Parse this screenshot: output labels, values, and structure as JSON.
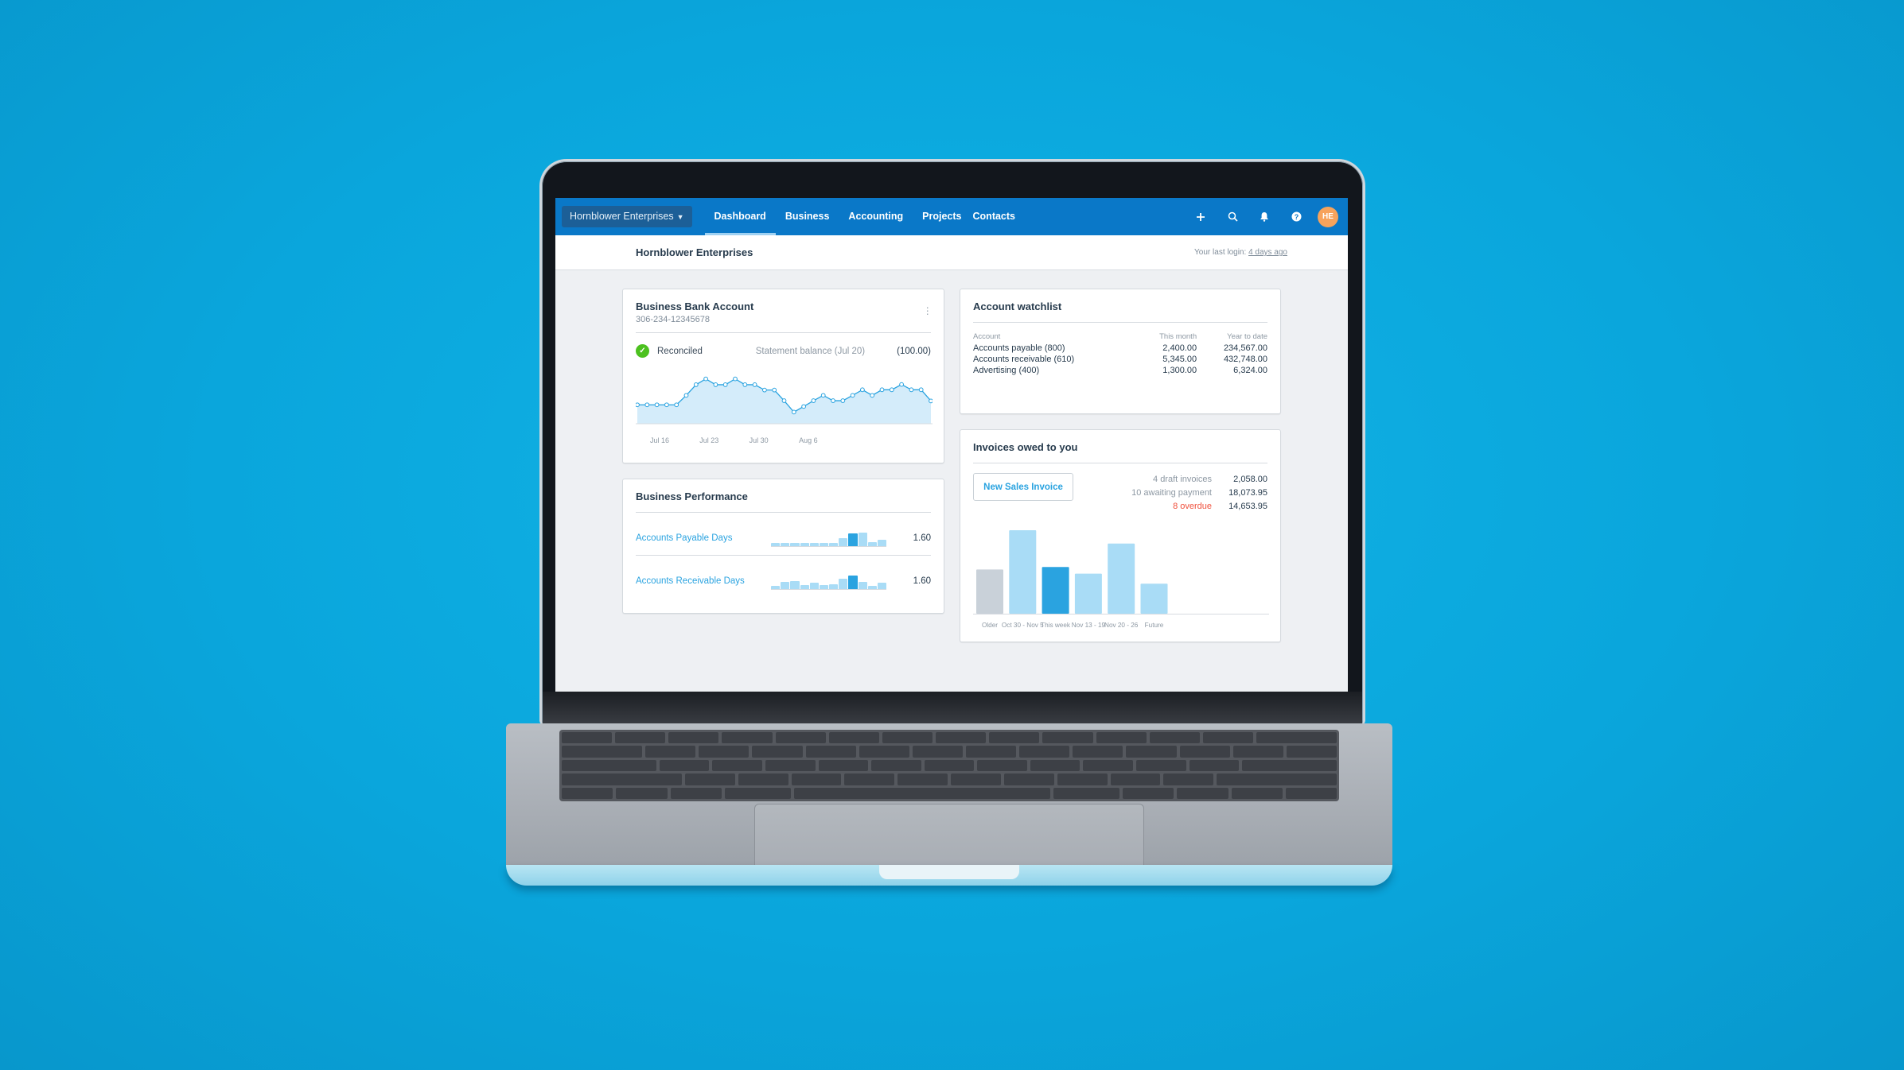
{
  "nav": {
    "org_switcher": "Hornblower Enterprises",
    "tabs": [
      {
        "label": "Dashboard",
        "active": true
      },
      {
        "label": "Business",
        "active": false
      },
      {
        "label": "Accounting",
        "active": false
      },
      {
        "label": "Projects",
        "active": false
      },
      {
        "label": "Contacts",
        "active": false
      }
    ],
    "icons": [
      "plus-icon",
      "search-icon",
      "bell-icon",
      "help-icon"
    ],
    "avatar_initials": "HE",
    "accent": "#0a78c8"
  },
  "subheader": {
    "org_name": "Hornblower Enterprises",
    "last_login_prefix": "Your last login:",
    "last_login_link": "4 days ago"
  },
  "bank_account": {
    "title": "Business Bank Account",
    "account_number": "306-234-12345678",
    "status": "Reconciled",
    "statement_label": "Statement balance (Jul 20)",
    "statement_amount": "(100.00)"
  },
  "performance": {
    "title": "Business Performance",
    "rows": [
      {
        "label": "Accounts Payable Days",
        "value": "1.60",
        "bars": [
          12,
          12,
          12,
          12,
          12,
          12,
          12,
          30,
          48,
          52,
          14,
          22
        ],
        "highlight": 8
      },
      {
        "label": "Accounts Receivable Days",
        "value": "1.60",
        "bars": [
          10,
          24,
          26,
          12,
          22,
          12,
          16,
          34,
          48,
          24,
          10,
          22
        ],
        "highlight": 8
      }
    ]
  },
  "watchlist": {
    "title": "Account watchlist",
    "columns": [
      "Account",
      "This month",
      "Year to date"
    ],
    "rows": [
      [
        "Accounts payable (800)",
        "2,400.00",
        "234,567.00"
      ],
      [
        "Accounts receivable (610)",
        "5,345.00",
        "432,748.00"
      ],
      [
        "Advertising (400)",
        "1,300.00",
        "6,324.00"
      ]
    ]
  },
  "invoices": {
    "title": "Invoices owed to you",
    "new_button": "New Sales Invoice",
    "stats": [
      {
        "label": "4 draft invoices",
        "value": "2,058.00",
        "status": "normal"
      },
      {
        "label": "10 awaiting payment",
        "value": "18,073.95",
        "status": "normal"
      },
      {
        "label": "8 overdue",
        "value": "14,653.95",
        "status": "overdue"
      }
    ]
  },
  "chart_data": [
    {
      "type": "line",
      "title": "Business Bank Account balance",
      "x_ticks": [
        "Jul 16",
        "Jul 23",
        "Jul 30",
        "Aug 6"
      ],
      "x_tick_positions": [
        1,
        3,
        5,
        7
      ],
      "values": [
        78,
        78,
        78,
        78,
        78,
        117,
        161,
        185,
        161,
        161,
        185,
        161,
        161,
        139,
        139,
        95,
        48,
        71,
        95,
        117,
        95,
        95,
        117,
        140,
        117,
        140,
        140,
        162,
        140,
        140,
        94
      ],
      "ylim": [
        0,
        210
      ],
      "fill": true,
      "color": "#2aa3e0",
      "grid": false
    },
    {
      "type": "bar",
      "title": "Invoices owed to you",
      "categories": [
        "Older",
        "Oct 30 - Nov 5",
        "This week",
        "Nov 13 - 19",
        "Nov 20 - 26",
        "Future"
      ],
      "values": [
        53,
        100,
        56,
        48,
        84,
        36
      ],
      "colors": [
        "#c9d1d9",
        "#a9dcf6",
        "#2aa3e0",
        "#a9dcf6",
        "#a9dcf6",
        "#a9dcf6"
      ],
      "ylim": [
        0,
        100
      ],
      "grid": false
    }
  ]
}
